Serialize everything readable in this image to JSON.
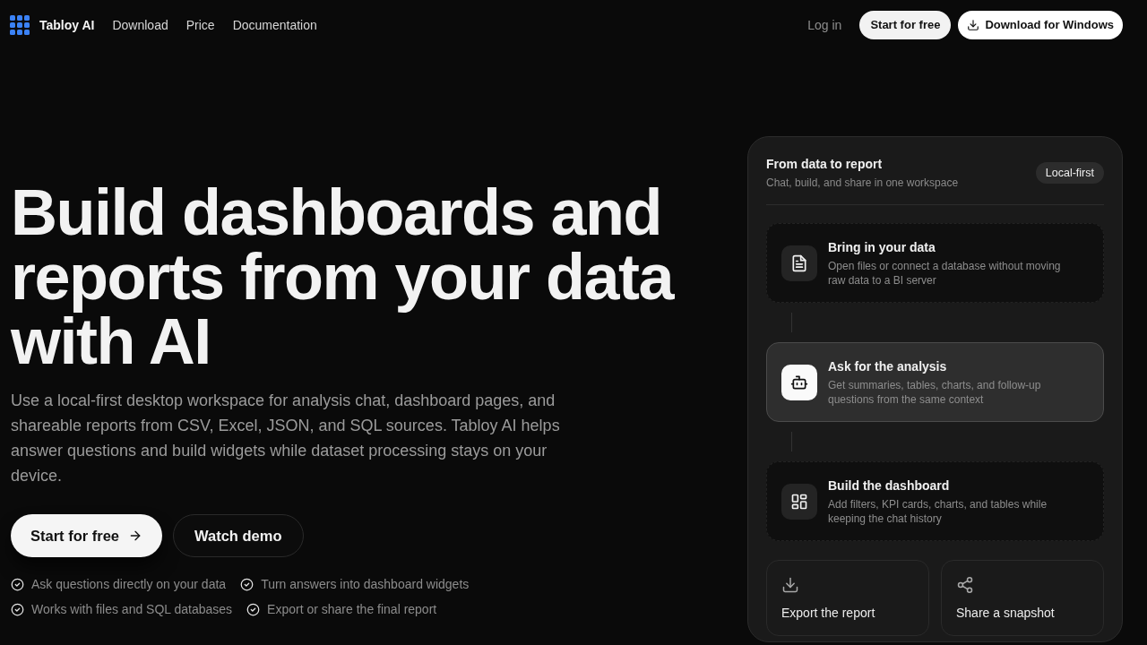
{
  "nav": {
    "brand": "Tabloy AI",
    "links": [
      "Download",
      "Price",
      "Documentation"
    ],
    "login": "Log in",
    "start_button": "Start for free",
    "download_button": "Download for Windows"
  },
  "hero": {
    "heading": "Build dashboards and reports from your data with AI",
    "description": "Use a local-first desktop workspace for analysis chat, dashboard pages, and shareable reports from CSV, Excel, JSON, and SQL sources. Tabloy AI helps answer questions and build widgets while dataset processing stays on your device.",
    "primary_button": "Start for free",
    "secondary_button": "Watch demo",
    "highlights": [
      "Ask questions directly on your data",
      "Turn answers into dashboard widgets",
      "Works with files and SQL databases",
      "Export or share the final report"
    ]
  },
  "workflow_card": {
    "title": "From data to report",
    "subtitle": "Chat, build, and share in one workspace",
    "badge": "Local-first",
    "steps": [
      {
        "title": "Bring in your data",
        "description": "Open files or connect a database without moving raw data to a BI server",
        "selected": false
      },
      {
        "title": "Ask for the analysis",
        "description": "Get summaries, tables, charts, and follow-up questions from the same context",
        "selected": true
      },
      {
        "title": "Build the dashboard",
        "description": "Add filters, KPI cards, charts, and tables while keeping the chat history",
        "selected": false
      }
    ],
    "actions": [
      "Export the report",
      "Share a snapshot"
    ]
  }
}
